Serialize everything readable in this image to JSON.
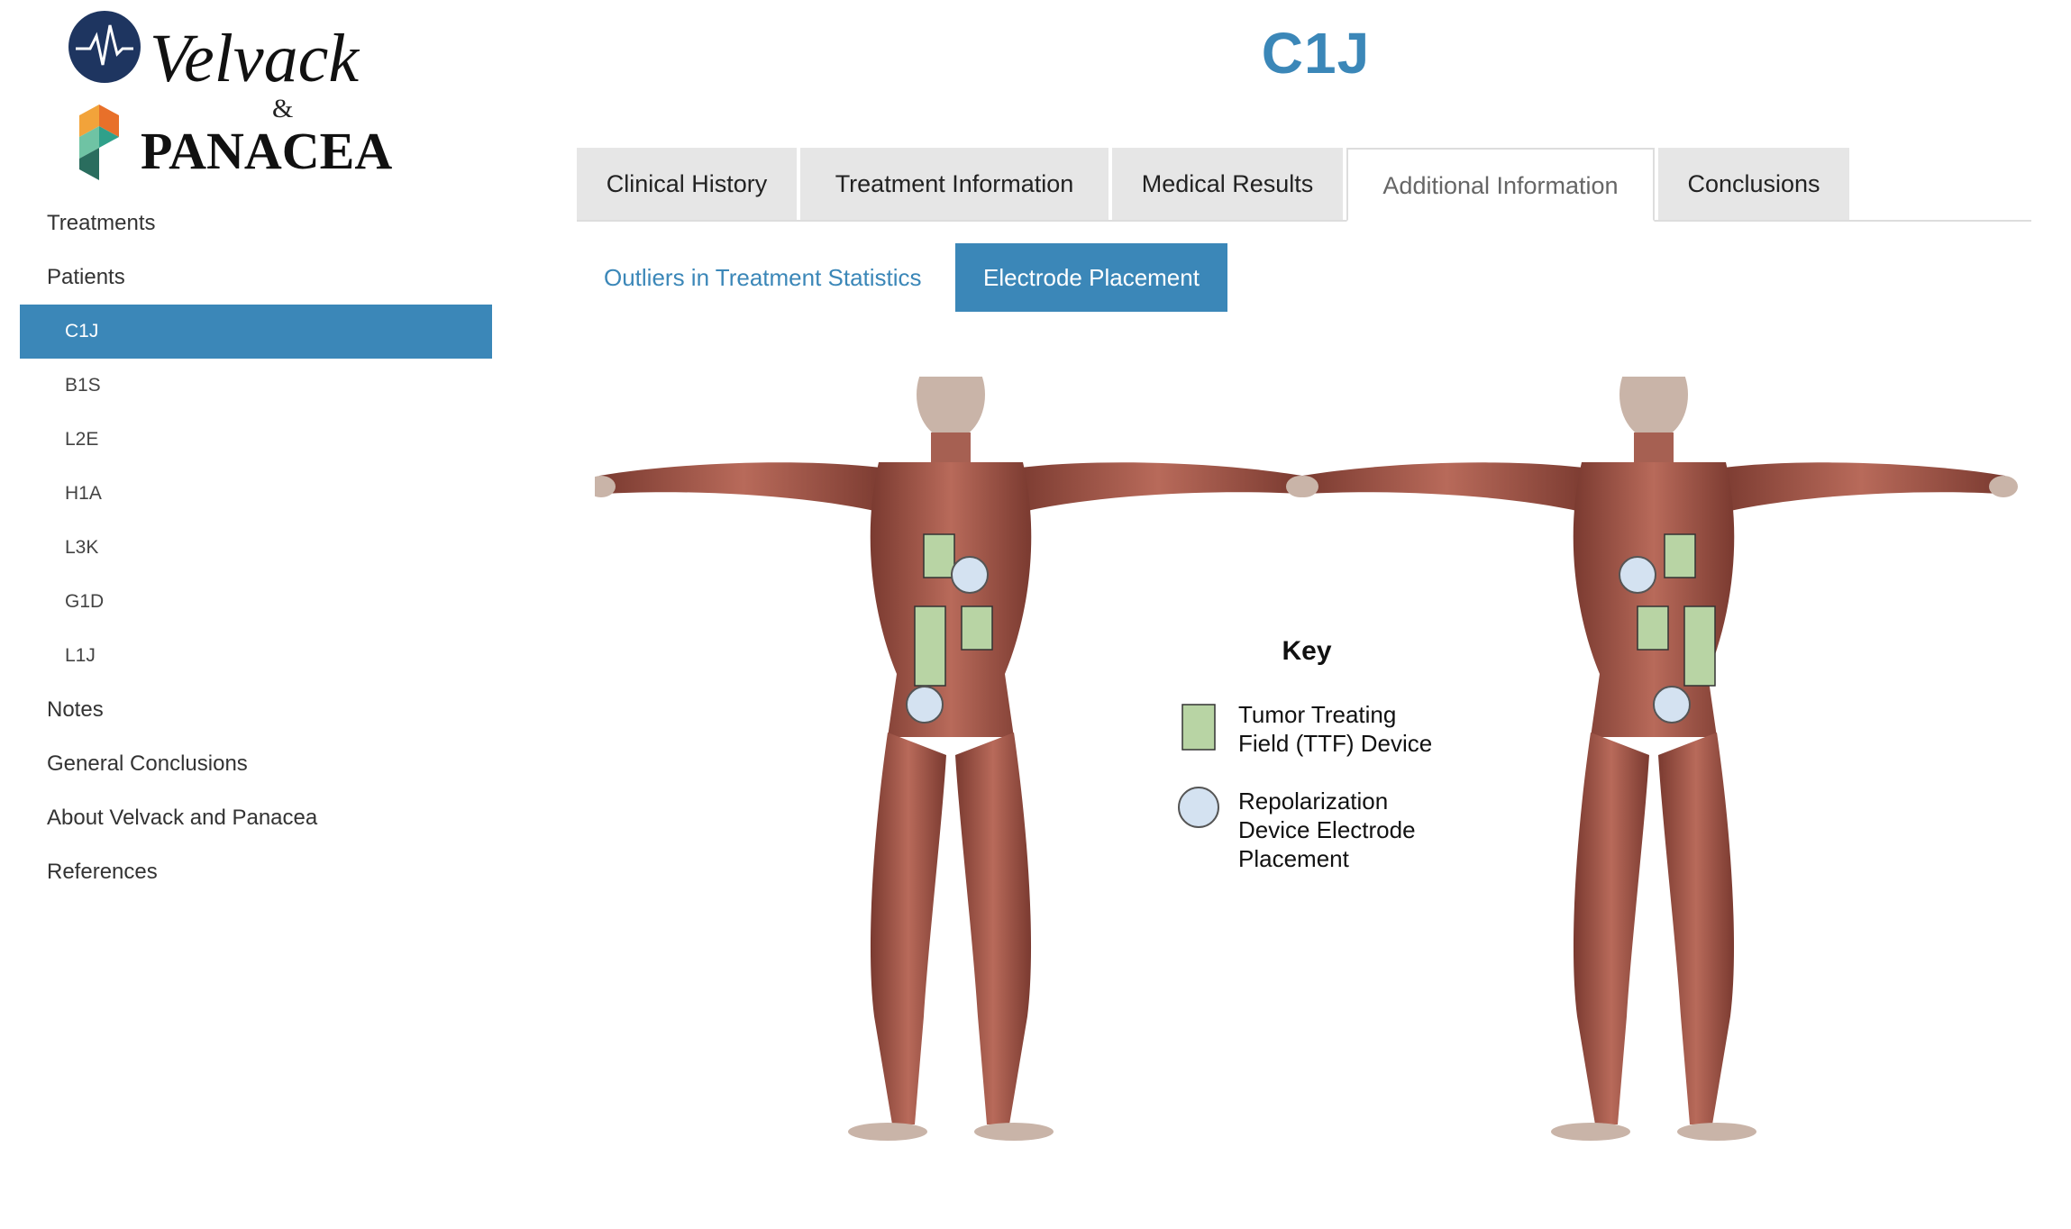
{
  "logo": {
    "name_top": "Velvack",
    "ampersand": "&",
    "name_bottom": "PANACEA"
  },
  "sidebar": {
    "items": [
      {
        "label": "Treatments"
      },
      {
        "label": "Patients"
      },
      {
        "label": "C1J",
        "active": true
      },
      {
        "label": "B1S"
      },
      {
        "label": "L2E"
      },
      {
        "label": "H1A"
      },
      {
        "label": "L3K"
      },
      {
        "label": "G1D"
      },
      {
        "label": "L1J"
      },
      {
        "label": "Notes"
      },
      {
        "label": "General Conclusions"
      },
      {
        "label": "About Velvack and Panacea"
      },
      {
        "label": "References"
      }
    ]
  },
  "page": {
    "title": "C1J"
  },
  "tabs": [
    {
      "label": "Clinical History"
    },
    {
      "label": "Treatment Information"
    },
    {
      "label": "Medical Results"
    },
    {
      "label": "Additional Information",
      "active": true
    },
    {
      "label": "Conclusions"
    }
  ],
  "subtabs": [
    {
      "label": "Outliers in Treatment Statistics"
    },
    {
      "label": "Electrode Placement",
      "active": true
    }
  ],
  "figure": {
    "key_title": "Key",
    "key_ttf_line1": "Tumor Treating",
    "key_ttf_line2": "Field (TTF) Device",
    "key_rep_line1": "Repolarization",
    "key_rep_line2": "Device Electrode",
    "key_rep_line3": "Placement"
  },
  "colors": {
    "accent": "#3b87b8",
    "ttf_device": "#b8d4a4",
    "electrode": "#d4e2f1",
    "muscle": "#a8574a"
  }
}
